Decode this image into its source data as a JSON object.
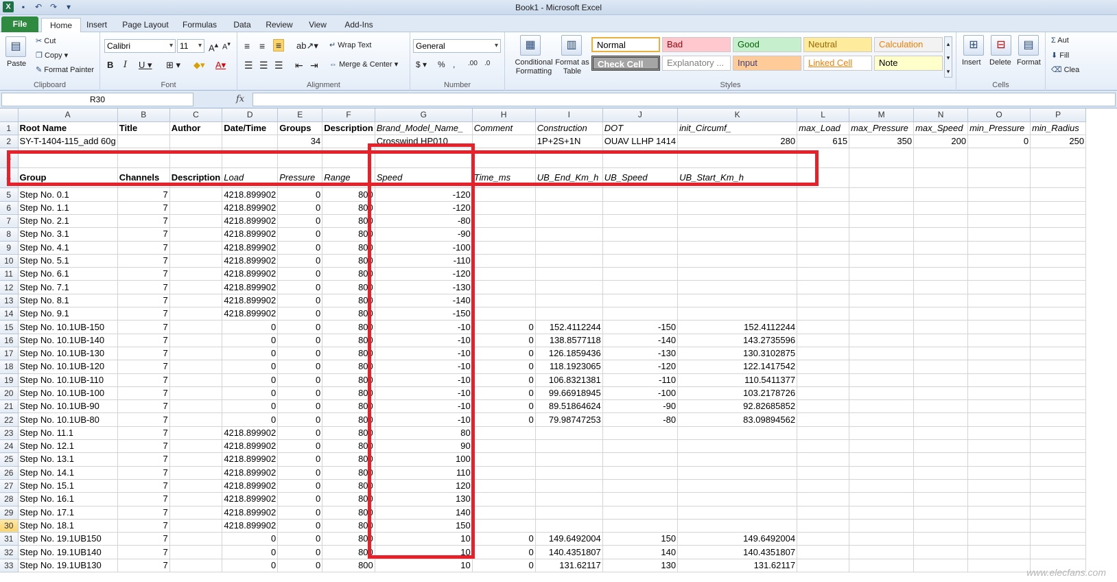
{
  "window": {
    "title": "Book1 - Microsoft Excel"
  },
  "tabs": [
    "File",
    "Home",
    "Insert",
    "Page Layout",
    "Formulas",
    "Data",
    "Review",
    "View",
    "Add-Ins"
  ],
  "clipboard": {
    "paste": "Paste",
    "cut": "Cut",
    "copy": "Copy",
    "format_painter": "Format Painter",
    "label": "Clipboard"
  },
  "font": {
    "name": "Calibri",
    "size": "11",
    "label": "Font"
  },
  "alignment": {
    "wrap": "Wrap Text",
    "merge": "Merge & Center",
    "label": "Alignment"
  },
  "number": {
    "format": "General",
    "label": "Number"
  },
  "styles": {
    "conditional": "Conditional Formatting",
    "format_table": "Format as Table",
    "label": "Styles",
    "cells": [
      {
        "name": "Normal",
        "bg": "#ffffff",
        "fg": "#000000"
      },
      {
        "name": "Bad",
        "bg": "#ffc7ce",
        "fg": "#9c0006"
      },
      {
        "name": "Good",
        "bg": "#c6efce",
        "fg": "#006100"
      },
      {
        "name": "Neutral",
        "bg": "#ffeb9c",
        "fg": "#9c6500"
      },
      {
        "name": "Calculation",
        "bg": "#f2f2f2",
        "fg": "#fa7d00"
      },
      {
        "name": "Check Cell",
        "bg": "#a5a5a5",
        "fg": "#ffffff"
      },
      {
        "name": "Explanatory ...",
        "bg": "#ffffff",
        "fg": "#7f7f7f"
      },
      {
        "name": "Input",
        "bg": "#ffcc99",
        "fg": "#3f3f76"
      },
      {
        "name": "Linked Cell",
        "bg": "#ffffff",
        "fg": "#fa7d00"
      },
      {
        "name": "Note",
        "bg": "#ffffcc",
        "fg": "#000000"
      }
    ]
  },
  "cells_group": {
    "insert": "Insert",
    "delete": "Delete",
    "format": "Format",
    "label": "Cells"
  },
  "editing": {
    "autosum": "Aut",
    "fill": "Fill",
    "clear": "Clea"
  },
  "formula_bar": {
    "name_box": "R30",
    "fx": "fx"
  },
  "columns": [
    "A",
    "B",
    "C",
    "D",
    "E",
    "F",
    "G",
    "H",
    "I",
    "J",
    "K",
    "L",
    "M",
    "N",
    "O",
    "P"
  ],
  "rows": [
    {
      "n": "1",
      "c": [
        "Root Name",
        "Title",
        "Author",
        "Date/Time",
        "Groups",
        "Description",
        "Brand_Model_Name_",
        "Comment",
        "Construction",
        "DOT",
        "init_Circumf_",
        "max_Load",
        "max_Pressure",
        "max_Speed",
        "min_Pressure",
        "min_Radius"
      ]
    },
    {
      "n": "2",
      "c": [
        "SY-T-1404-115_add 60g",
        "",
        "",
        "",
        "34",
        "",
        "Crosswind HP010",
        "",
        "1P+2S+1N",
        "OUAV  LLHP 1414",
        "280",
        "615",
        "350",
        "200",
        "0",
        "250"
      ]
    },
    {
      "n": "3",
      "c": [
        "",
        "",
        "",
        "",
        "",
        "",
        "",
        "",
        "",
        "",
        "",
        "",
        "",
        "",
        "",
        ""
      ]
    },
    {
      "n": "4",
      "c": [
        "Group",
        "Channels",
        "Description",
        "Load",
        "Pressure",
        "Range",
        "Speed",
        "Time_ms",
        "UB_End_Km_h",
        "UB_Speed",
        "UB_Start_Km_h",
        "",
        "",
        "",
        "",
        ""
      ]
    },
    {
      "n": "5",
      "c": [
        "Step No. 0.1",
        "7",
        "",
        "4218.899902",
        "0",
        "800",
        "-120",
        "",
        "",
        "",
        "",
        "",
        "",
        "",
        "",
        ""
      ]
    },
    {
      "n": "6",
      "c": [
        "Step No. 1.1",
        "7",
        "",
        "4218.899902",
        "0",
        "800",
        "-120",
        "",
        "",
        "",
        "",
        "",
        "",
        "",
        "",
        ""
      ]
    },
    {
      "n": "7",
      "c": [
        "Step No. 2.1",
        "7",
        "",
        "4218.899902",
        "0",
        "800",
        "-80",
        "",
        "",
        "",
        "",
        "",
        "",
        "",
        "",
        ""
      ]
    },
    {
      "n": "8",
      "c": [
        "Step No. 3.1",
        "7",
        "",
        "4218.899902",
        "0",
        "800",
        "-90",
        "",
        "",
        "",
        "",
        "",
        "",
        "",
        "",
        ""
      ]
    },
    {
      "n": "9",
      "c": [
        "Step No. 4.1",
        "7",
        "",
        "4218.899902",
        "0",
        "800",
        "-100",
        "",
        "",
        "",
        "",
        "",
        "",
        "",
        "",
        ""
      ]
    },
    {
      "n": "10",
      "c": [
        "Step No. 5.1",
        "7",
        "",
        "4218.899902",
        "0",
        "800",
        "-110",
        "",
        "",
        "",
        "",
        "",
        "",
        "",
        "",
        ""
      ]
    },
    {
      "n": "11",
      "c": [
        "Step No. 6.1",
        "7",
        "",
        "4218.899902",
        "0",
        "800",
        "-120",
        "",
        "",
        "",
        "",
        "",
        "",
        "",
        "",
        ""
      ]
    },
    {
      "n": "12",
      "c": [
        "Step No. 7.1",
        "7",
        "",
        "4218.899902",
        "0",
        "800",
        "-130",
        "",
        "",
        "",
        "",
        "",
        "",
        "",
        "",
        ""
      ]
    },
    {
      "n": "13",
      "c": [
        "Step No. 8.1",
        "7",
        "",
        "4218.899902",
        "0",
        "800",
        "-140",
        "",
        "",
        "",
        "",
        "",
        "",
        "",
        "",
        ""
      ]
    },
    {
      "n": "14",
      "c": [
        "Step No. 9.1",
        "7",
        "",
        "4218.899902",
        "0",
        "800",
        "-150",
        "",
        "",
        "",
        "",
        "",
        "",
        "",
        "",
        ""
      ]
    },
    {
      "n": "15",
      "c": [
        "Step No. 10.1UB-150",
        "7",
        "",
        "0",
        "0",
        "800",
        "-10",
        "0",
        "152.4112244",
        "-150",
        "152.4112244",
        "",
        "",
        "",
        "",
        ""
      ]
    },
    {
      "n": "16",
      "c": [
        "Step No. 10.1UB-140",
        "7",
        "",
        "0",
        "0",
        "800",
        "-10",
        "0",
        "138.8577118",
        "-140",
        "143.2735596",
        "",
        "",
        "",
        "",
        ""
      ]
    },
    {
      "n": "17",
      "c": [
        "Step No. 10.1UB-130",
        "7",
        "",
        "0",
        "0",
        "800",
        "-10",
        "0",
        "126.1859436",
        "-130",
        "130.3102875",
        "",
        "",
        "",
        "",
        ""
      ]
    },
    {
      "n": "18",
      "c": [
        "Step No. 10.1UB-120",
        "7",
        "",
        "0",
        "0",
        "800",
        "-10",
        "0",
        "118.1923065",
        "-120",
        "122.1417542",
        "",
        "",
        "",
        "",
        ""
      ]
    },
    {
      "n": "19",
      "c": [
        "Step No. 10.1UB-110",
        "7",
        "",
        "0",
        "0",
        "800",
        "-10",
        "0",
        "106.8321381",
        "-110",
        "110.5411377",
        "",
        "",
        "",
        "",
        ""
      ]
    },
    {
      "n": "20",
      "c": [
        "Step No. 10.1UB-100",
        "7",
        "",
        "0",
        "0",
        "800",
        "-10",
        "0",
        "99.66918945",
        "-100",
        "103.2178726",
        "",
        "",
        "",
        "",
        ""
      ]
    },
    {
      "n": "21",
      "c": [
        "Step No. 10.1UB-90",
        "7",
        "",
        "0",
        "0",
        "800",
        "-10",
        "0",
        "89.51864624",
        "-90",
        "92.82685852",
        "",
        "",
        "",
        "",
        ""
      ]
    },
    {
      "n": "22",
      "c": [
        "Step No. 10.1UB-80",
        "7",
        "",
        "0",
        "0",
        "800",
        "-10",
        "0",
        "79.98747253",
        "-80",
        "83.09894562",
        "",
        "",
        "",
        "",
        ""
      ]
    },
    {
      "n": "23",
      "c": [
        "Step No. 11.1",
        "7",
        "",
        "4218.899902",
        "0",
        "800",
        "80",
        "",
        "",
        "",
        "",
        "",
        "",
        "",
        "",
        ""
      ]
    },
    {
      "n": "24",
      "c": [
        "Step No. 12.1",
        "7",
        "",
        "4218.899902",
        "0",
        "800",
        "90",
        "",
        "",
        "",
        "",
        "",
        "",
        "",
        "",
        ""
      ]
    },
    {
      "n": "25",
      "c": [
        "Step No. 13.1",
        "7",
        "",
        "4218.899902",
        "0",
        "800",
        "100",
        "",
        "",
        "",
        "",
        "",
        "",
        "",
        "",
        ""
      ]
    },
    {
      "n": "26",
      "c": [
        "Step No. 14.1",
        "7",
        "",
        "4218.899902",
        "0",
        "800",
        "110",
        "",
        "",
        "",
        "",
        "",
        "",
        "",
        "",
        ""
      ]
    },
    {
      "n": "27",
      "c": [
        "Step No. 15.1",
        "7",
        "",
        "4218.899902",
        "0",
        "800",
        "120",
        "",
        "",
        "",
        "",
        "",
        "",
        "",
        "",
        ""
      ]
    },
    {
      "n": "28",
      "c": [
        "Step No. 16.1",
        "7",
        "",
        "4218.899902",
        "0",
        "800",
        "130",
        "",
        "",
        "",
        "",
        "",
        "",
        "",
        "",
        ""
      ]
    },
    {
      "n": "29",
      "c": [
        "Step No. 17.1",
        "7",
        "",
        "4218.899902",
        "0",
        "800",
        "140",
        "",
        "",
        "",
        "",
        "",
        "",
        "",
        "",
        ""
      ]
    },
    {
      "n": "30",
      "c": [
        "Step No. 18.1",
        "7",
        "",
        "4218.899902",
        "0",
        "800",
        "150",
        "",
        "",
        "",
        "",
        "",
        "",
        "",
        "",
        ""
      ]
    },
    {
      "n": "31",
      "c": [
        "Step No. 19.1UB150",
        "7",
        "",
        "0",
        "0",
        "800",
        "10",
        "0",
        "149.6492004",
        "150",
        "149.6492004",
        "",
        "",
        "",
        "",
        ""
      ]
    },
    {
      "n": "32",
      "c": [
        "Step No. 19.1UB140",
        "7",
        "",
        "0",
        "0",
        "800",
        "10",
        "0",
        "140.4351807",
        "140",
        "140.4351807",
        "",
        "",
        "",
        "",
        ""
      ]
    },
    {
      "n": "33",
      "c": [
        "Step No. 19.1UB130",
        "7",
        "",
        "0",
        "0",
        "800",
        "10",
        "0",
        "131.62117",
        "130",
        "131.62117",
        "",
        "",
        "",
        "",
        ""
      ]
    }
  ],
  "selected_row": "30",
  "watermark": "www.elecfans.com"
}
